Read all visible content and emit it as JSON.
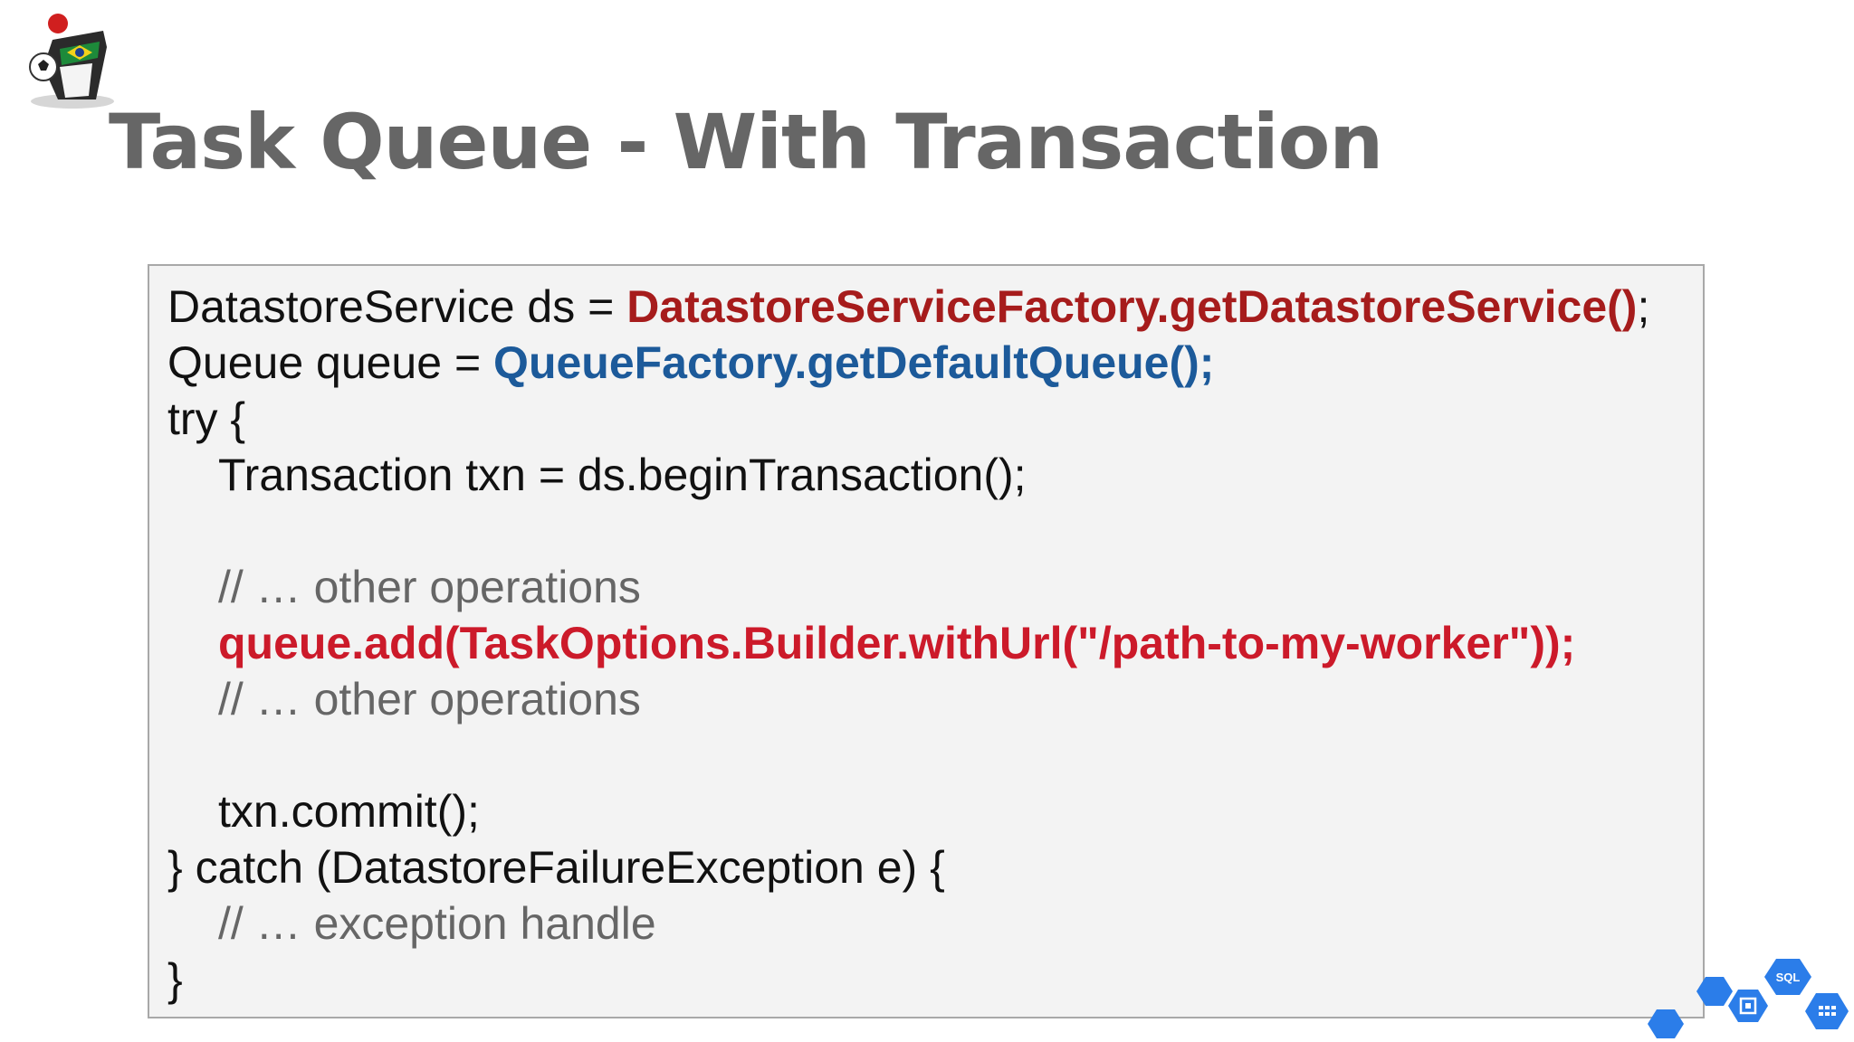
{
  "slide": {
    "title": "Task Queue - With Transaction"
  },
  "code": {
    "line1": {
      "plain": "DatastoreService ds = ",
      "highlight": "DatastoreServiceFactory.getDatastoreService()",
      "tail": ";"
    },
    "line2": {
      "plain": "Queue queue = ",
      "highlight": "QueueFactory.getDefaultQueue();"
    },
    "line3": "try {",
    "line4": "Transaction txn = ds.beginTransaction();",
    "line5": "",
    "line6": "// … other operations",
    "line7": "queue.add(TaskOptions.Builder.withUrl(\"/path-to-my-worker\"));",
    "line8": "// … other operations",
    "line9": "",
    "line10": "txn.commit();",
    "line11": "} catch (DatastoreFailureException e) {",
    "line12": "// … exception handle",
    "line13": "}"
  },
  "decor": {
    "logo_icon": "duke-mascot-icon",
    "hex_badge_label": "SQL",
    "colors": {
      "title": "#666666",
      "code_text": "#111111",
      "dark_red": "#a61c1c",
      "blue": "#1c5a9a",
      "red": "#cc1a2a",
      "comment": "#666666",
      "box_bg": "#f3f3f3",
      "hex_blue": "#2b7de9"
    }
  }
}
